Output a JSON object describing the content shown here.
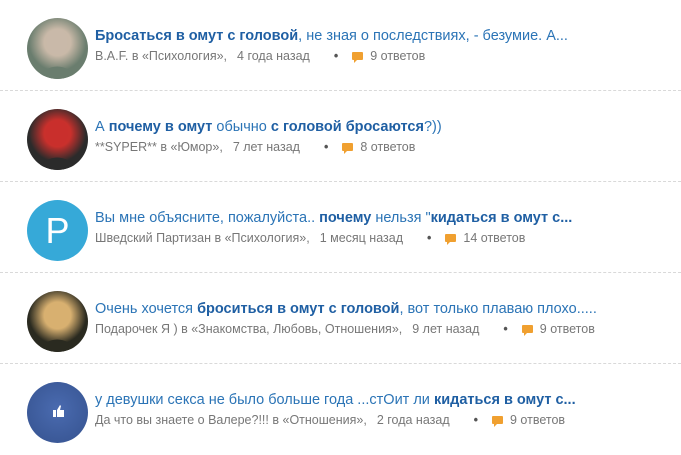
{
  "items": [
    {
      "title_parts": [
        {
          "text": "Бросаться в омут с головой",
          "bold": true
        },
        {
          "text": ", не зная о последствиях, - безумие. А...",
          "bold": false
        }
      ],
      "author": "B.A.F.",
      "category": "в «Психология»,",
      "time": "4 года назад",
      "answers": "9 ответов",
      "avatar_icon": "user-photo-icon",
      "avatar_colors": [
        "#6a7d6e",
        "#c9b9a8"
      ]
    },
    {
      "title_parts": [
        {
          "text": "А ",
          "bold": false
        },
        {
          "text": "почему в омут",
          "bold": true
        },
        {
          "text": " обычно ",
          "bold": false
        },
        {
          "text": "с головой бросаются",
          "bold": true
        },
        {
          "text": "?))",
          "bold": false
        }
      ],
      "author": "**SYPER**",
      "category": "в «Юмор»,",
      "time": "7 лет назад",
      "answers": "8 ответов",
      "avatar_icon": "user-photo-icon",
      "avatar_colors": [
        "#2b2b2b",
        "#c9302c"
      ]
    },
    {
      "title_parts": [
        {
          "text": "Вы мне объясните, пожалуйста.. ",
          "bold": false
        },
        {
          "text": "почему",
          "bold": true
        },
        {
          "text": " нельзя \"",
          "bold": false
        },
        {
          "text": "кидаться в омут с...",
          "bold": true
        }
      ],
      "author": "Шведский Партизан",
      "category": "в «Психология»,",
      "time": "1 месяц назад",
      "answers": "14 ответов",
      "avatar_icon": "letter-avatar-icon",
      "avatar_letter": "P",
      "avatar_colors": [
        "#36a9d8",
        "#ffffff"
      ]
    },
    {
      "title_parts": [
        {
          "text": "Очень хочется ",
          "bold": false
        },
        {
          "text": "броситься в омут с головой",
          "bold": true
        },
        {
          "text": ", вот только плаваю плохо.....",
          "bold": false
        }
      ],
      "author": "Подарочек Я )",
      "category": "в «Знакомства, Любовь, Отношения»,",
      "time": "9 лет назад",
      "answers": "9 ответов",
      "avatar_icon": "user-photo-icon",
      "avatar_colors": [
        "#2a2a20",
        "#d8b070"
      ]
    },
    {
      "title_parts": [
        {
          "text": "у девушки секса не было больше года ...стОит ли ",
          "bold": false
        },
        {
          "text": "кидаться в омут с...",
          "bold": true
        }
      ],
      "author": "Да что вы знаете о Валере?!!!",
      "category": "в «Отношения»,",
      "time": "2 года назад",
      "answers": "9 ответов",
      "avatar_icon": "like-avatar-icon",
      "avatar_colors": [
        "#3b5998",
        "#ffffff"
      ]
    }
  ]
}
